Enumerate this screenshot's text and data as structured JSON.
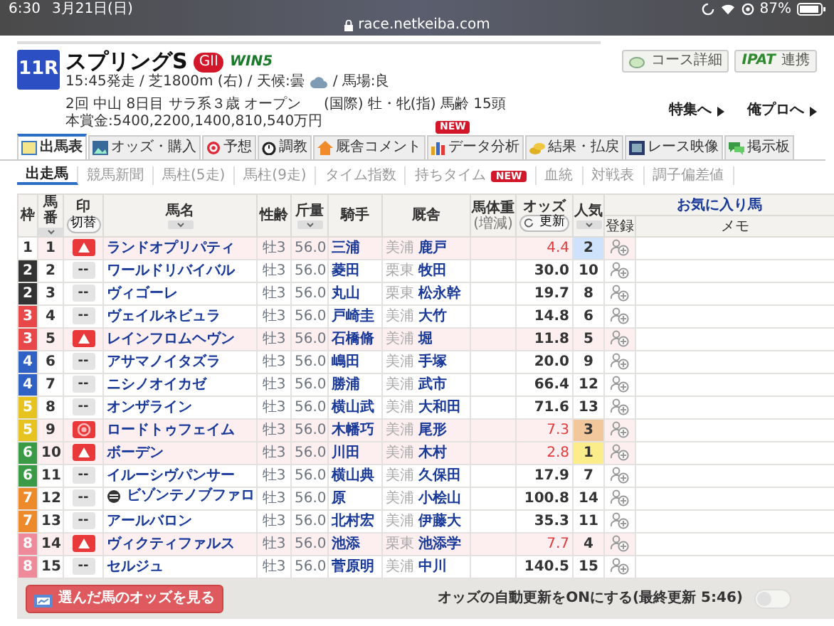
{
  "status_bar": {
    "time": "6:30",
    "date": "3月21日(日)",
    "battery": "87%",
    "url": "race.netkeiba.com"
  },
  "race": {
    "number": "11R",
    "name": "スプリングS",
    "grade": "GII",
    "win5": "WIN5",
    "line_1": "15:45発走 / 芝1800m (右) / 天候:曇",
    "track": "/ 馬場:良",
    "line_2": "2回 中山 8日目 サラ系３歳 オープン",
    "line_2b": "(国際) 牡・牝(指) 馬齢 15頭",
    "prize": "本賞金:5400,2200,1400,810,540万円"
  },
  "header_buttons": [
    {
      "kind": "course",
      "label": "コース詳細"
    },
    {
      "kind": "ipat",
      "logo": "IPAT",
      "label": "連携"
    }
  ],
  "header_links": [
    "特集へ",
    "俺プロへ"
  ],
  "tabs": [
    {
      "label": "出馬表",
      "selected": true
    },
    {
      "label": "オッズ・購入",
      "selected": false
    },
    {
      "label": "予想",
      "selected": false
    },
    {
      "label": "調教",
      "selected": false
    },
    {
      "label": "厩舎コメント",
      "selected": false
    },
    {
      "label": "データ分析",
      "selected": false,
      "badge": "NEW"
    },
    {
      "label": "結果・払戻",
      "selected": false
    },
    {
      "label": "レース映像",
      "selected": false
    },
    {
      "label": "掲示板",
      "selected": false
    }
  ],
  "subtabs": [
    {
      "label": "出走馬",
      "selected": true
    },
    {
      "label": "競馬新聞",
      "selected": false
    },
    {
      "label": "馬柱(5走)",
      "selected": false
    },
    {
      "label": "馬柱(9走)",
      "selected": false
    },
    {
      "label": "タイム指数",
      "selected": false
    },
    {
      "label": "持ちタイム",
      "selected": false,
      "badge": "NEW"
    },
    {
      "label": "血統",
      "selected": false
    },
    {
      "label": "対戦表",
      "selected": false
    },
    {
      "label": "調子偏差値",
      "selected": false
    }
  ],
  "table": {
    "columns": {
      "waku": "枠",
      "umaban_1": "馬",
      "umaban_2": "番",
      "mark": "印",
      "mark_button": "切替",
      "name": "馬名",
      "sexage": "性齢",
      "weight": "斤量",
      "jockey": "騎手",
      "stable": "厩舎",
      "body_1": "馬体重",
      "body_2": "(増減)",
      "odds": "オッズ",
      "odds_button": "更新",
      "pop": "人気",
      "fav": "お気に入り馬",
      "reg": "登録",
      "memo": "メモ"
    },
    "rows": [
      {
        "waku": {
          "text": "1",
          "color": "#ffffff"
        },
        "num": "1",
        "mark": {
          "kind": "triangle"
        },
        "name": "ランドオプリパティ",
        "blinkers": false,
        "sexage": "牡3",
        "weight": "56.0",
        "jockey": "三浦",
        "region": "美浦",
        "trainer": "鹿戸",
        "odds": "4.4",
        "hot": true,
        "pop": {
          "text": "2",
          "color": "#cfe2fb"
        }
      },
      {
        "waku": {
          "text": "2",
          "color": "#333333"
        },
        "num": "2",
        "mark": {
          "kind": "none",
          "text": "--"
        },
        "name": "ワールドリバイバル",
        "blinkers": false,
        "sexage": "牡3",
        "weight": "56.0",
        "jockey": "菱田",
        "region": "栗東",
        "trainer": "牧田",
        "odds": "30.0",
        "hot": false,
        "pop": {
          "text": "10"
        }
      },
      {
        "waku": {
          "text": "2",
          "color": "#333333"
        },
        "num": "3",
        "mark": {
          "kind": "none",
          "text": "--"
        },
        "name": "ヴィゴーレ",
        "blinkers": false,
        "sexage": "牡3",
        "weight": "56.0",
        "jockey": "丸山",
        "region": "栗東",
        "trainer": "松永幹",
        "odds": "19.7",
        "hot": false,
        "pop": {
          "text": "8"
        }
      },
      {
        "waku": {
          "text": "3",
          "color": "#e8484a"
        },
        "num": "4",
        "mark": {
          "kind": "none",
          "text": "--"
        },
        "name": "ヴェイルネビュラ",
        "blinkers": false,
        "sexage": "牡3",
        "weight": "56.0",
        "jockey": "戸崎圭",
        "region": "美浦",
        "trainer": "大竹",
        "odds": "14.8",
        "hot": false,
        "pop": {
          "text": "6"
        }
      },
      {
        "waku": {
          "text": "3",
          "color": "#e8484a"
        },
        "num": "5",
        "mark": {
          "kind": "triangle"
        },
        "name": "レインフロムヘヴン",
        "blinkers": false,
        "sexage": "牡3",
        "weight": "56.0",
        "jockey": "石橋脩",
        "region": "美浦",
        "trainer": "堀",
        "odds": "11.8",
        "hot": false,
        "pop": {
          "text": "5"
        }
      },
      {
        "waku": {
          "text": "4",
          "color": "#2f62c4"
        },
        "num": "6",
        "mark": {
          "kind": "none",
          "text": "--"
        },
        "name": "アサマノイタズラ",
        "blinkers": false,
        "sexage": "牡3",
        "weight": "56.0",
        "jockey": "嶋田",
        "region": "美浦",
        "trainer": "手塚",
        "odds": "20.0",
        "hot": false,
        "pop": {
          "text": "9"
        }
      },
      {
        "waku": {
          "text": "4",
          "color": "#2f62c4"
        },
        "num": "7",
        "mark": {
          "kind": "none",
          "text": "--"
        },
        "name": "ニシノオイカゼ",
        "blinkers": false,
        "sexage": "牡3",
        "weight": "56.0",
        "jockey": "勝浦",
        "region": "美浦",
        "trainer": "武市",
        "odds": "66.4",
        "hot": false,
        "pop": {
          "text": "12"
        }
      },
      {
        "waku": {
          "text": "5",
          "color": "#e6c320"
        },
        "num": "8",
        "mark": {
          "kind": "none",
          "text": "--"
        },
        "name": "オンザライン",
        "blinkers": false,
        "sexage": "牡3",
        "weight": "56.0",
        "jockey": "横山武",
        "region": "美浦",
        "trainer": "大和田",
        "odds": "71.6",
        "hot": false,
        "pop": {
          "text": "13"
        }
      },
      {
        "waku": {
          "text": "5",
          "color": "#e6c320"
        },
        "num": "9",
        "mark": {
          "kind": "double-circle"
        },
        "name": "ロードトゥフェイム",
        "blinkers": false,
        "sexage": "牡3",
        "weight": "56.0",
        "jockey": "木幡巧",
        "region": "美浦",
        "trainer": "尾形",
        "odds": "7.3",
        "hot": true,
        "pop": {
          "text": "3",
          "color": "#f2c79b"
        }
      },
      {
        "waku": {
          "text": "6",
          "color": "#3a9a45"
        },
        "num": "10",
        "mark": {
          "kind": "triangle"
        },
        "name": "ボーデン",
        "blinkers": false,
        "sexage": "牡3",
        "weight": "56.0",
        "jockey": "川田",
        "region": "美浦",
        "trainer": "木村",
        "odds": "2.8",
        "hot": true,
        "pop": {
          "text": "1",
          "color": "#fbee8a"
        }
      },
      {
        "waku": {
          "text": "6",
          "color": "#3a9a45"
        },
        "num": "11",
        "mark": {
          "kind": "none",
          "text": "--"
        },
        "name": "イルーシヴパンサー",
        "blinkers": false,
        "sexage": "牡3",
        "weight": "56.0",
        "jockey": "横山典",
        "region": "美浦",
        "trainer": "久保田",
        "odds": "17.9",
        "hot": false,
        "pop": {
          "text": "7"
        }
      },
      {
        "waku": {
          "text": "7",
          "color": "#ec8a2c"
        },
        "num": "12",
        "mark": {
          "kind": "none",
          "text": "--"
        },
        "name": "ビゾンテノブファロ",
        "blinkers": true,
        "sexage": "牡3",
        "weight": "56.0",
        "jockey": "原",
        "region": "美浦",
        "trainer": "小桧山",
        "odds": "100.8",
        "hot": false,
        "pop": {
          "text": "14"
        }
      },
      {
        "waku": {
          "text": "7",
          "color": "#ec8a2c"
        },
        "num": "13",
        "mark": {
          "kind": "none",
          "text": "--"
        },
        "name": "アールバロン",
        "blinkers": false,
        "sexage": "牡3",
        "weight": "56.0",
        "jockey": "北村宏",
        "region": "美浦",
        "trainer": "伊藤大",
        "odds": "35.3",
        "hot": false,
        "pop": {
          "text": "11"
        }
      },
      {
        "waku": {
          "text": "8",
          "color": "#ee8a9a"
        },
        "num": "14",
        "mark": {
          "kind": "triangle"
        },
        "name": "ヴィクティファルス",
        "blinkers": false,
        "sexage": "牡3",
        "weight": "56.0",
        "jockey": "池添",
        "region": "栗東",
        "trainer": "池添学",
        "odds": "7.7",
        "hot": true,
        "pop": {
          "text": "4"
        }
      },
      {
        "waku": {
          "text": "8",
          "color": "#ee8a9a"
        },
        "num": "15",
        "mark": {
          "kind": "none",
          "text": "--"
        },
        "name": "セルジュ",
        "blinkers": false,
        "sexage": "牡3",
        "weight": "56.0",
        "jockey": "菅原明",
        "region": "美浦",
        "trainer": "中川",
        "odds": "140.5",
        "hot": false,
        "pop": {
          "text": "15"
        }
      }
    ]
  },
  "footer": {
    "button": "選んだ馬のオッズを見る",
    "auto_update": "オッズの自動更新をONにする(最終更新 5:46)",
    "on": false
  }
}
